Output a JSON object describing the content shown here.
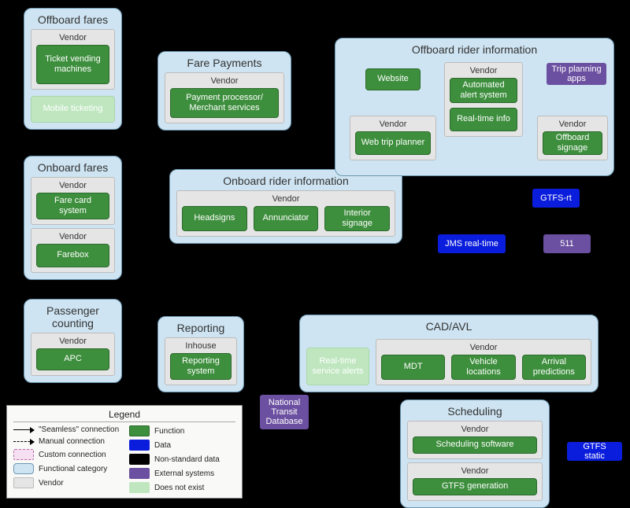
{
  "categories": {
    "offboard_fares": {
      "title": "Offboard fares",
      "vendor_label": "Vendor",
      "tvm": "Ticket vending machines",
      "mobile": "Mobile ticketing"
    },
    "onboard_fares": {
      "title": "Onboard fares",
      "v1": "Vendor",
      "farecard": "Fare card system",
      "v2": "Vendor",
      "farebox": "Farebox"
    },
    "fare_payments": {
      "title": "Fare Payments",
      "vendor_label": "Vendor",
      "processor": "Payment processor/ Merchant services"
    },
    "passenger_counting": {
      "title": "Passenger counting",
      "vendor_label": "Vendor",
      "apc": "APC"
    },
    "reporting": {
      "title": "Reporting",
      "inhouse_label": "Inhouse",
      "system": "Reporting system"
    },
    "onboard_rider": {
      "title": "Onboard rider information",
      "vendor_label": "Vendor",
      "headsigns": "Headsigns",
      "annunciator": "Annunciator",
      "interior": "Interior signage"
    },
    "offboard_rider": {
      "title": "Offboard rider information",
      "website": "Website",
      "v_mid": "Vendor",
      "alert": "Automated alert system",
      "realtime": "Real-time info",
      "v_left": "Vendor",
      "wtp": "Web trip planner",
      "v_right": "Vendor",
      "signage": "Offboard signage"
    },
    "cad_avl": {
      "title": "CAD/AVL",
      "vendor_label": "Vendor",
      "alerts": "Real-time service alerts",
      "mdt": "MDT",
      "vloc": "Vehicle locations",
      "arrpred": "Arrival predictions"
    },
    "scheduling": {
      "title": "Scheduling",
      "v1": "Vendor",
      "sw": "Scheduling software",
      "v2": "Vendor",
      "gtfsgen": "GTFS generation"
    }
  },
  "data": {
    "jms": "JMS real-time",
    "gtfs_rt": "GTFS-rt",
    "gtfs_static": "GTFS static"
  },
  "external": {
    "trip_apps": "Trip planning apps",
    "five11": "511",
    "ntd": "National Transit Database"
  },
  "legend": {
    "title": "Legend",
    "seamless": "\"Seamless\" connection",
    "manual": "Manual connection",
    "custom": "Custom connection",
    "category": "Functional category",
    "vendor": "Vendor",
    "function": "Function",
    "data": "Data",
    "nonstd": "Non-standard data",
    "ext": "External systems",
    "dne": "Does not exist"
  }
}
